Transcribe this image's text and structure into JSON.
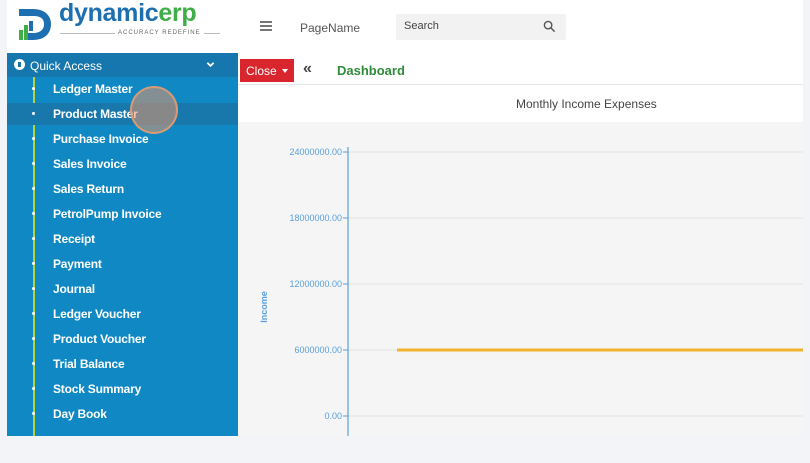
{
  "brand": {
    "name_part1": "dynamic",
    "name_part2": "erp",
    "tagline": "ACCURACY REDEFINE"
  },
  "topbar": {
    "page_name": "PageName",
    "search_placeholder": "Search"
  },
  "sidebar": {
    "section_label": "Quick Access",
    "items": [
      {
        "label": "Ledger Master"
      },
      {
        "label": "Product Master",
        "active": true
      },
      {
        "label": "Purchase Invoice"
      },
      {
        "label": "Sales Invoice"
      },
      {
        "label": "Sales Return"
      },
      {
        "label": "PetrolPump Invoice"
      },
      {
        "label": "Receipt"
      },
      {
        "label": "Payment"
      },
      {
        "label": "Journal"
      },
      {
        "label": "Ledger Voucher"
      },
      {
        "label": "Product Voucher"
      },
      {
        "label": "Trial Balance"
      },
      {
        "label": "Stock Summary"
      },
      {
        "label": "Day Book"
      }
    ]
  },
  "tabbar": {
    "close_label": "Close",
    "collapse_glyph": "«",
    "active_tab": "Dashboard"
  },
  "colors": {
    "sidebar": "#0f88c4",
    "close": "#d9262e",
    "tab": "#2e8b3a",
    "series": "#f0b32b",
    "axis": "#5aa0dc"
  },
  "chart_data": {
    "type": "line",
    "title": "Monthly Income Expenses",
    "ylabel": "Income",
    "yticks": [
      "24000000.00",
      "18000000.00",
      "12000000.00",
      "6000000.00",
      "0.00"
    ],
    "ylim": [
      0,
      24000000
    ],
    "series": [
      {
        "values": [
          6000000,
          6000000
        ]
      }
    ]
  }
}
